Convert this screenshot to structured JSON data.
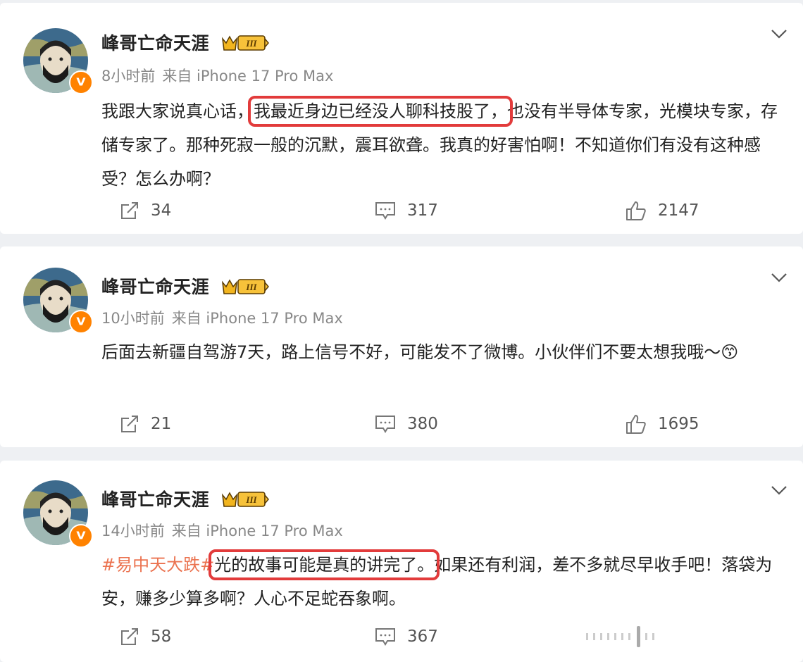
{
  "posts": [
    {
      "username": "峰哥亡命天涯",
      "time": "8小时前",
      "source": "来自 iPhone 17 Pro Max",
      "content_before": "我跟大家说真心话，",
      "content_highlight": "我最近身边已经没人聊科技股了，",
      "content_after": "也没有半导体专家，光模块专家，存储专家了。那种死寂一般的沉默，震耳欲聋。我真的好害怕啊！不知道你们有没有这种感受？怎么办啊？",
      "shares": "34",
      "comments": "317",
      "likes": "2147"
    },
    {
      "username": "峰哥亡命天涯",
      "time": "10小时前",
      "source": "来自 iPhone 17 Pro Max",
      "content": "后面去新疆自驾游7天，路上信号不好，可能发不了微博。小伙伴们不要太想我哦～",
      "emoji": "😙",
      "shares": "21",
      "comments": "380",
      "likes": "1695"
    },
    {
      "username": "峰哥亡命天涯",
      "time": "14小时前",
      "source": "来自 iPhone 17 Pro Max",
      "hashtag": "#易中天大跌#",
      "content_highlight": "光的故事可能是真的讲完了。",
      "content_after": "如果还有利润，差不多就尽早收手吧！落袋为安，赚多少算多啊？人心不足蛇吞象啊。",
      "shares": "58",
      "comments": "367"
    }
  ],
  "badge": {
    "level": "III",
    "verified": "V"
  },
  "colors": {
    "highlight": "#e23b3b",
    "hashtag": "#eb7350",
    "verified": "#ff8200",
    "meta": "#888888"
  }
}
